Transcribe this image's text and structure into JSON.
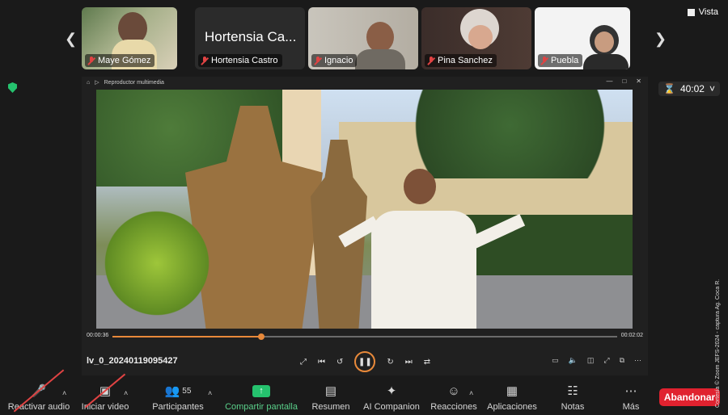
{
  "participants": [
    {
      "name": "Maye Gómez",
      "muted": true
    },
    {
      "name": "Hortensia Castro",
      "display_title": "Hortensia Ca...",
      "muted": true
    },
    {
      "name": "Ignacio",
      "muted": true
    },
    {
      "name": "Pina Sanchez",
      "muted": true
    },
    {
      "name": "Puebla",
      "muted": true
    }
  ],
  "view_label": "Vista",
  "timer": "40:02",
  "player": {
    "title": "Reproductor multimedia",
    "elapsed": "00:00:36",
    "total": "00:02:02",
    "progress": 0.295,
    "filename": "lv_0_20240119095427"
  },
  "toolbar": {
    "items": [
      {
        "label": "Reactivar audio",
        "icon": "mic-muted-icon"
      },
      {
        "label": "Iniciar video",
        "icon": "video-off-icon"
      },
      {
        "label": "Participantes",
        "icon": "participants-icon",
        "count": "55"
      },
      {
        "label": "Compartir pantalla",
        "icon": "share-screen-icon"
      },
      {
        "label": "Resumen",
        "icon": "summary-icon"
      },
      {
        "label": "AI Companion",
        "icon": "ai-companion-icon"
      },
      {
        "label": "Reacciones",
        "icon": "reactions-icon"
      },
      {
        "label": "Aplicaciones",
        "icon": "apps-icon"
      },
      {
        "label": "Notas",
        "icon": "notes-icon"
      },
      {
        "label": "Más",
        "icon": "more-icon"
      }
    ],
    "leave_label": "Abandonar"
  },
  "credit": "Cortesía © Zoom JEFS-2024 - captura Ag. Coca R.",
  "colors": {
    "accent": "#e8893a",
    "leave": "#e0222f",
    "share": "#25c26e"
  }
}
